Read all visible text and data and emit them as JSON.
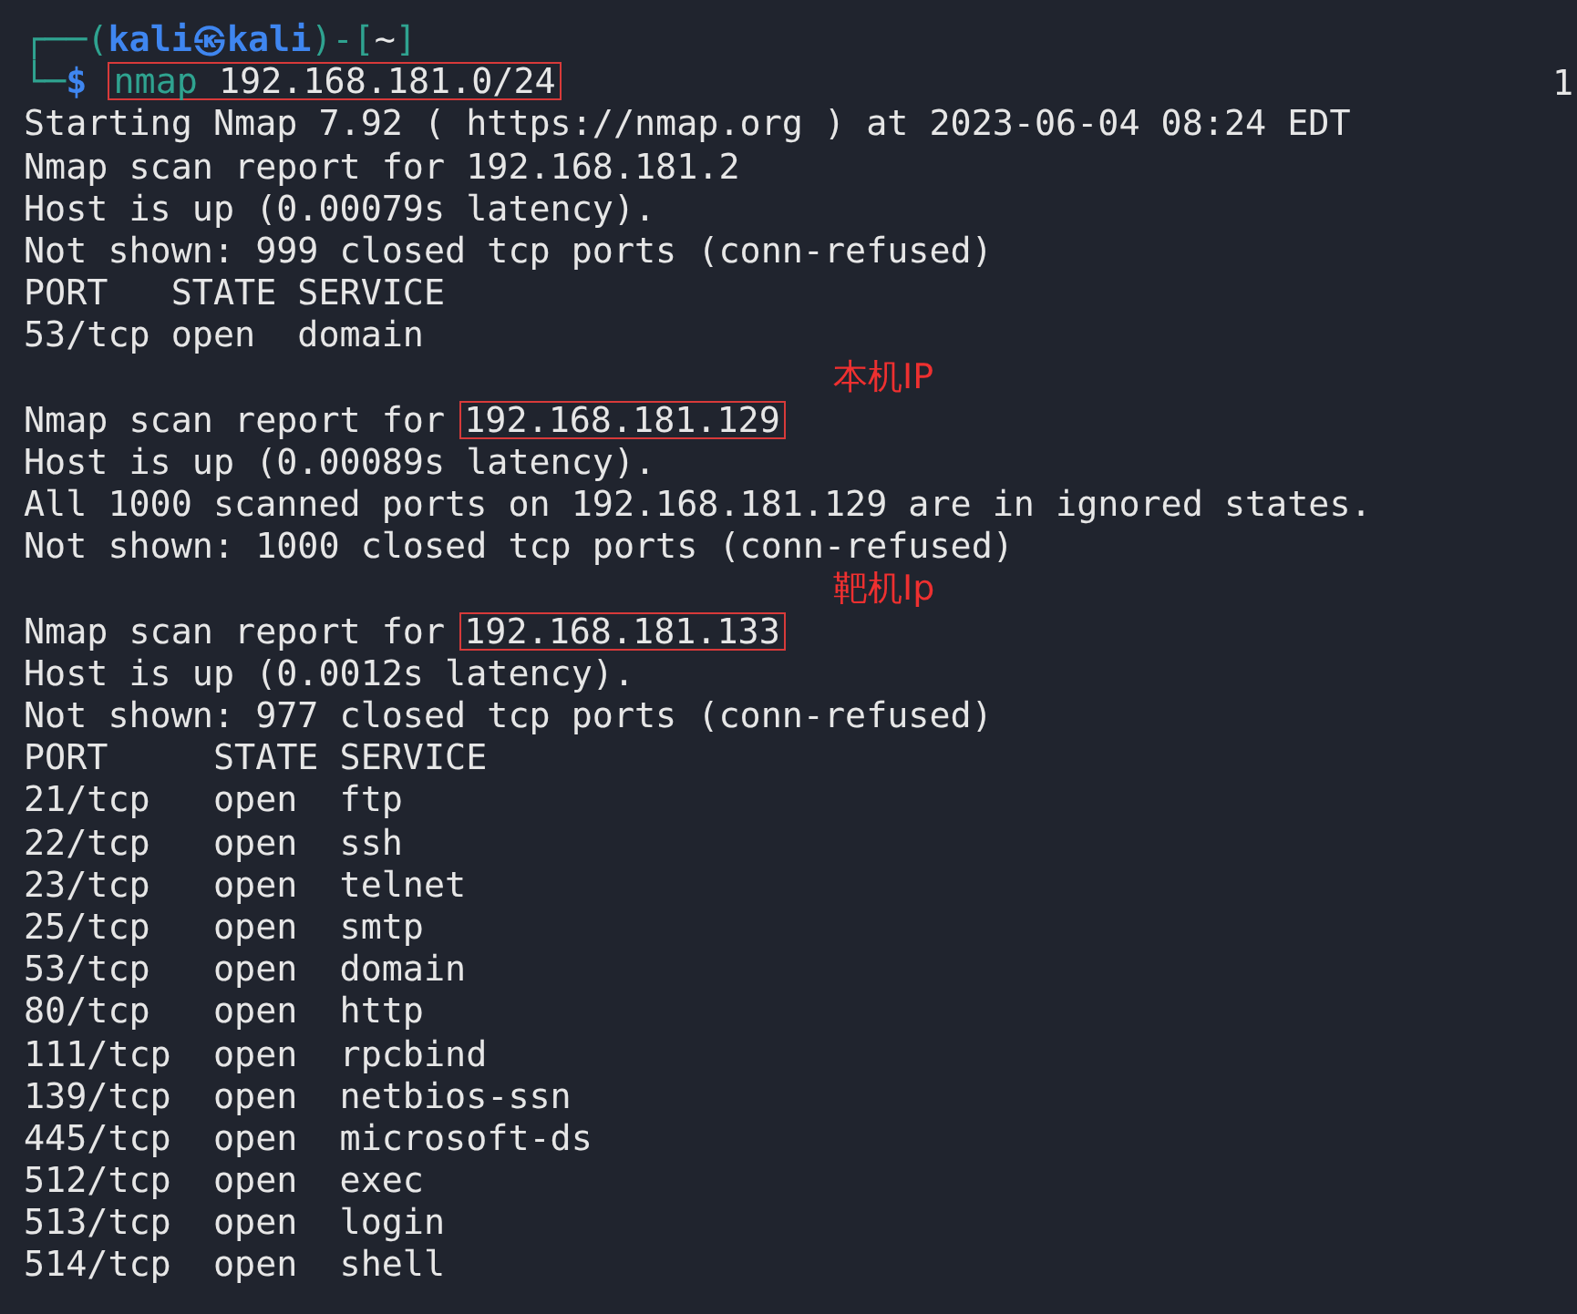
{
  "terminal": {
    "right_prompt": "1",
    "lines": [
      {
        "kind": "prompt",
        "segments": [
          {
            "text": "┌──(",
            "kind": "frame"
          },
          {
            "text": "kali",
            "kind": "user"
          },
          {
            "text": "㉿",
            "kind": "user"
          },
          {
            "text": "kali",
            "kind": "user"
          },
          {
            "text": ")-[",
            "kind": "frame"
          },
          {
            "text": "~",
            "kind": "dir"
          },
          {
            "text": "]",
            "kind": "frame"
          }
        ]
      },
      {
        "kind": "command",
        "segments": [
          {
            "text": "└─",
            "kind": "frame"
          },
          {
            "text": "$",
            "kind": "sigil"
          }
        ],
        "program": "nmap",
        "args": " 192.168.181.0/24"
      },
      {
        "kind": "text",
        "text": "Starting Nmap 7.92 ( https://nmap.org ) at 2023-06-04 08:24 EDT"
      },
      {
        "kind": "text",
        "text": "Nmap scan report for 192.168.181.2"
      },
      {
        "kind": "text",
        "text": "Host is up (0.00079s latency)."
      },
      {
        "kind": "text",
        "text": "Not shown: 999 closed tcp ports (conn-refused)"
      },
      {
        "kind": "text",
        "text": "PORT   STATE SERVICE"
      },
      {
        "kind": "text",
        "text": "53/tcp open  domain"
      },
      {
        "kind": "blank"
      },
      {
        "kind": "report",
        "text": "Nmap scan report for ",
        "highlight": "192.168.181.129",
        "annotation": "本机IP"
      },
      {
        "kind": "text",
        "text": "Host is up (0.00089s latency)."
      },
      {
        "kind": "text",
        "text": "All 1000 scanned ports on 192.168.181.129 are in ignored states."
      },
      {
        "kind": "text",
        "text": "Not shown: 1000 closed tcp ports (conn-refused)"
      },
      {
        "kind": "blank"
      },
      {
        "kind": "report",
        "text": "Nmap scan report for ",
        "highlight": "192.168.181.133",
        "annotation": "靶机Ip"
      },
      {
        "kind": "text",
        "text": "Host is up (0.0012s latency)."
      },
      {
        "kind": "text",
        "text": "Not shown: 977 closed tcp ports (conn-refused)"
      },
      {
        "kind": "text",
        "text": "PORT     STATE SERVICE"
      },
      {
        "kind": "text",
        "text": "21/tcp   open  ftp"
      },
      {
        "kind": "text",
        "text": "22/tcp   open  ssh"
      },
      {
        "kind": "text",
        "text": "23/tcp   open  telnet"
      },
      {
        "kind": "text",
        "text": "25/tcp   open  smtp"
      },
      {
        "kind": "text",
        "text": "53/tcp   open  domain"
      },
      {
        "kind": "text",
        "text": "80/tcp   open  http"
      },
      {
        "kind": "text",
        "text": "111/tcp  open  rpcbind"
      },
      {
        "kind": "text",
        "text": "139/tcp  open  netbios-ssn"
      },
      {
        "kind": "text",
        "text": "445/tcp  open  microsoft-ds"
      },
      {
        "kind": "text",
        "text": "512/tcp  open  exec"
      },
      {
        "kind": "text",
        "text": "513/tcp  open  login"
      },
      {
        "kind": "text",
        "text": "514/tcp  open  shell"
      }
    ]
  }
}
